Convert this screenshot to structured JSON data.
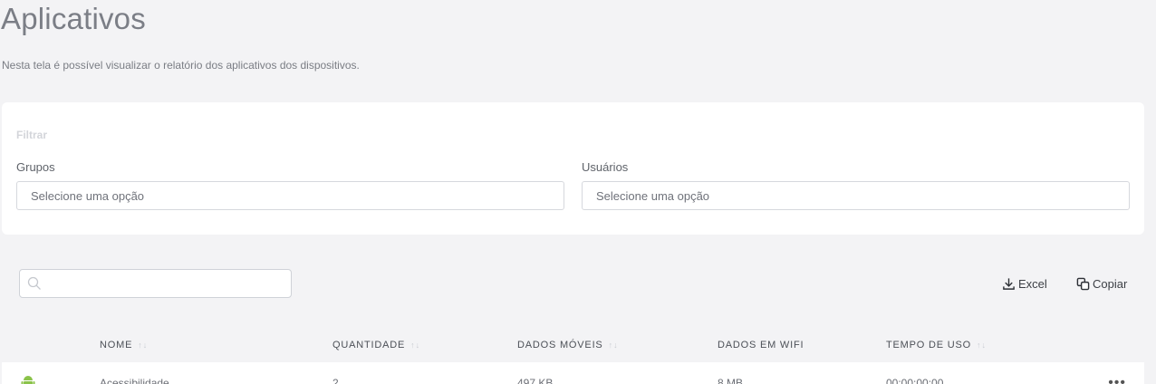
{
  "page": {
    "title": "Aplicativos",
    "subtitle": "Nesta tela é possível visualizar o relatório dos aplicativos dos dispositivos."
  },
  "filter": {
    "title": "Filtrar",
    "groups_label": "Grupos",
    "groups_placeholder": "Selecione uma opção",
    "users_label": "Usuários",
    "users_placeholder": "Selecione uma opção"
  },
  "toolbar": {
    "search_placeholder": "",
    "excel_label": "Excel",
    "copy_label": "Copiar"
  },
  "table": {
    "columns": [
      "NOME",
      "QUANTIDADE",
      "DADOS MÓVEIS",
      "DADOS EM WIFI",
      "TEMPO DE USO"
    ],
    "sort_arrows": "↑↓",
    "rows": [
      {
        "icon": "android-icon",
        "name": "Acessibilidade",
        "quantity": "2",
        "mobile_data": "497 KB",
        "wifi_data": "8 MB",
        "usage_time": "00:00:00:00",
        "menu": "•••"
      }
    ]
  },
  "colors": {
    "background": "#f3f3f5",
    "card": "#ffffff",
    "android_green": "#8bc34a"
  }
}
